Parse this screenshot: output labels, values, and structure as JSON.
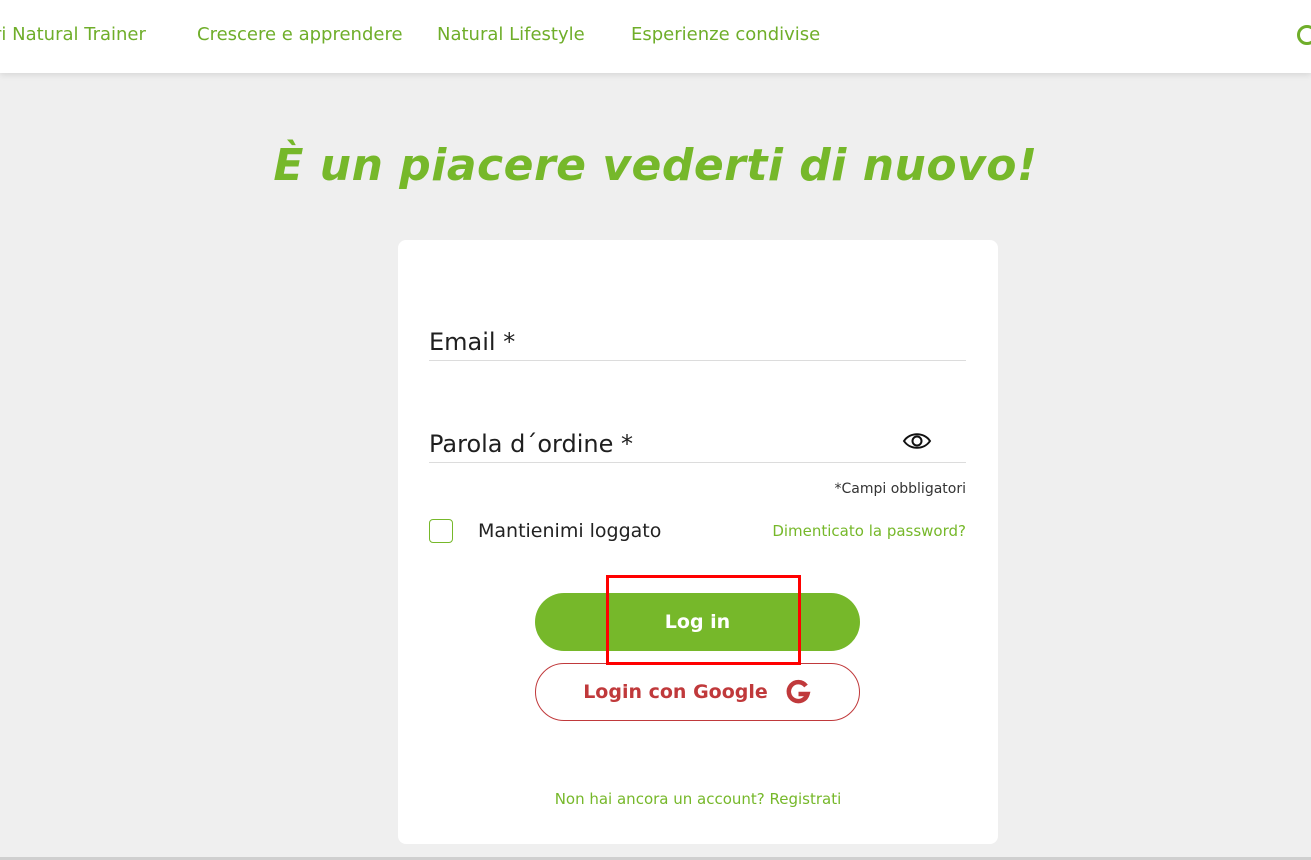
{
  "nav": {
    "items": [
      "ri Natural Trainer",
      "Crescere e apprendere",
      "Natural Lifestyle",
      "Esperienze condivise"
    ]
  },
  "headline": "È un piacere vederti di nuovo!",
  "form": {
    "email_label": "Email *",
    "password_label": "Parola d´ordine *",
    "required_note": "*Campi obbligatori",
    "keep_logged_label": "Mantienimi loggato",
    "forgot_link": "Dimenticato la password?",
    "login_button": "Log in",
    "google_button": "Login con Google",
    "register_link": "Non hai ancora un account? Registrati"
  },
  "colors": {
    "brand_green": "#76b82a",
    "google_red": "#c0393b",
    "highlight": "#ff0000"
  },
  "icons": [
    "search-icon",
    "eye-icon",
    "google-g-icon"
  ]
}
